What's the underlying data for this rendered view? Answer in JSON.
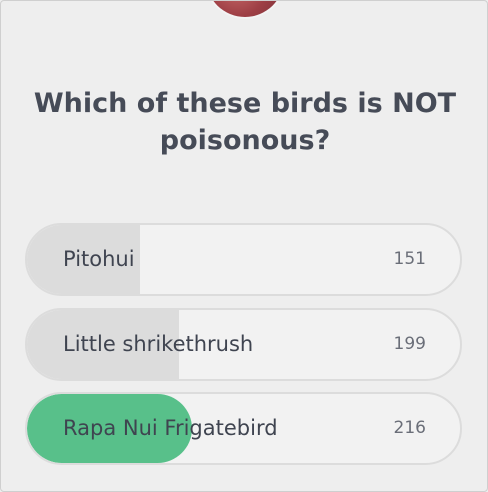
{
  "poll": {
    "question_line1": "Which of these birds is NOT",
    "question_line2": "poisonous?",
    "accent_color": "#58c08a",
    "options": [
      {
        "label": "Pitohui",
        "count": "151",
        "fill_fraction": 0.26,
        "selected": false
      },
      {
        "label": "Little shrikethrush",
        "count": "199",
        "fill_fraction": 0.35,
        "selected": false
      },
      {
        "label": "Rapa Nui Frigatebird",
        "count": "216",
        "fill_fraction": 0.38,
        "selected": true
      }
    ]
  }
}
